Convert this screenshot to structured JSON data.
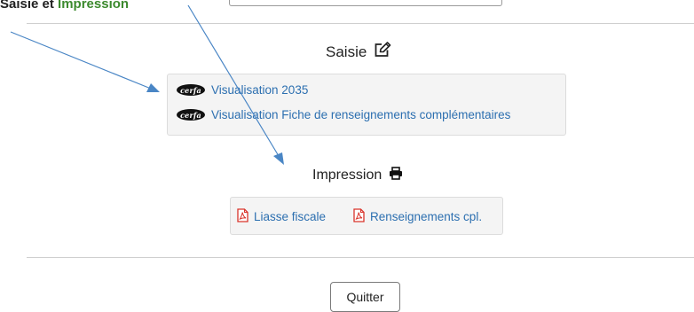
{
  "top": {
    "text_prefix": "Saisie et ",
    "text_green": "Impression"
  },
  "saisie": {
    "title": "Saisie",
    "icon": "edit-icon",
    "links": [
      {
        "badge": "cerfa",
        "label": "Visualisation 2035"
      },
      {
        "badge": "cerfa",
        "label": "Visualisation Fiche de renseignements complémentaires"
      }
    ]
  },
  "impression": {
    "title": "Impression",
    "icon": "printer-icon",
    "links": [
      {
        "icon": "pdf-icon",
        "label": "Liasse fiscale"
      },
      {
        "icon": "pdf-icon",
        "label": "Renseignements cpl."
      }
    ]
  },
  "footer": {
    "quit_label": "Quitter"
  },
  "colors": {
    "link": "#2c6fb0",
    "pdf": "#d9342b",
    "arrow": "#4a86c5",
    "panel_bg": "#f4f4f4"
  }
}
